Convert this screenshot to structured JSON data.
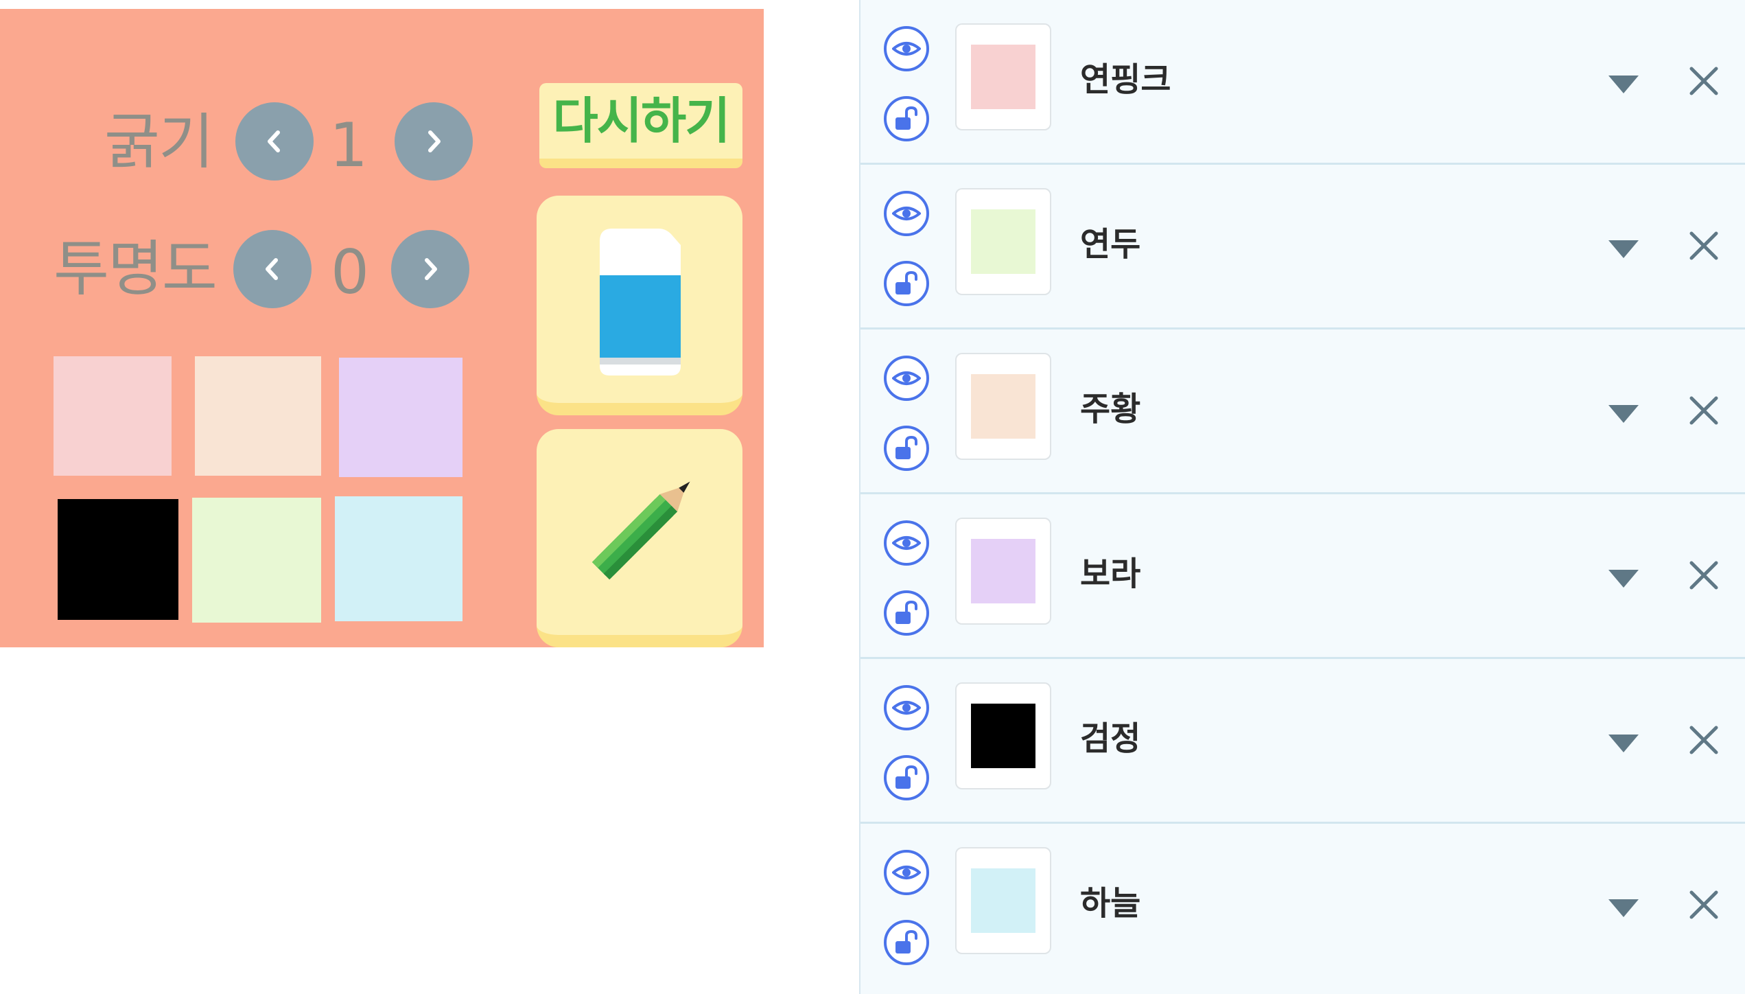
{
  "brush_panel": {
    "thickness": {
      "label": "굵기",
      "value": "1"
    },
    "opacity": {
      "label": "투명도",
      "value": "0"
    },
    "reset_label": "다시하기",
    "palette": [
      {
        "color": "#f8d1d1"
      },
      {
        "color": "#f9e4d4"
      },
      {
        "color": "#e5d0f7"
      },
      {
        "color": "#000000"
      },
      {
        "color": "#e8f8d4"
      },
      {
        "color": "#d2f1f7"
      }
    ]
  },
  "layers": [
    {
      "name": "연핑크",
      "color": "#f8d1d1"
    },
    {
      "name": "연두",
      "color": "#e8f8d4"
    },
    {
      "name": "주황",
      "color": "#f9e4d4"
    },
    {
      "name": "보라",
      "color": "#e5d0f7"
    },
    {
      "name": "검정",
      "color": "#000000"
    },
    {
      "name": "하늘",
      "color": "#d2f1f7"
    }
  ],
  "icons": {
    "visibility": "eye-icon",
    "lock": "unlock-icon",
    "menu": "caret-down-icon",
    "delete": "close-icon",
    "eraser": "eraser-icon",
    "pencil": "pencil-icon"
  },
  "colors": {
    "panel_bg": "#fba88f",
    "button_yellow": "#fdf1b6",
    "reset_text": "#45b44a",
    "accent_blue": "#4a73ea"
  }
}
